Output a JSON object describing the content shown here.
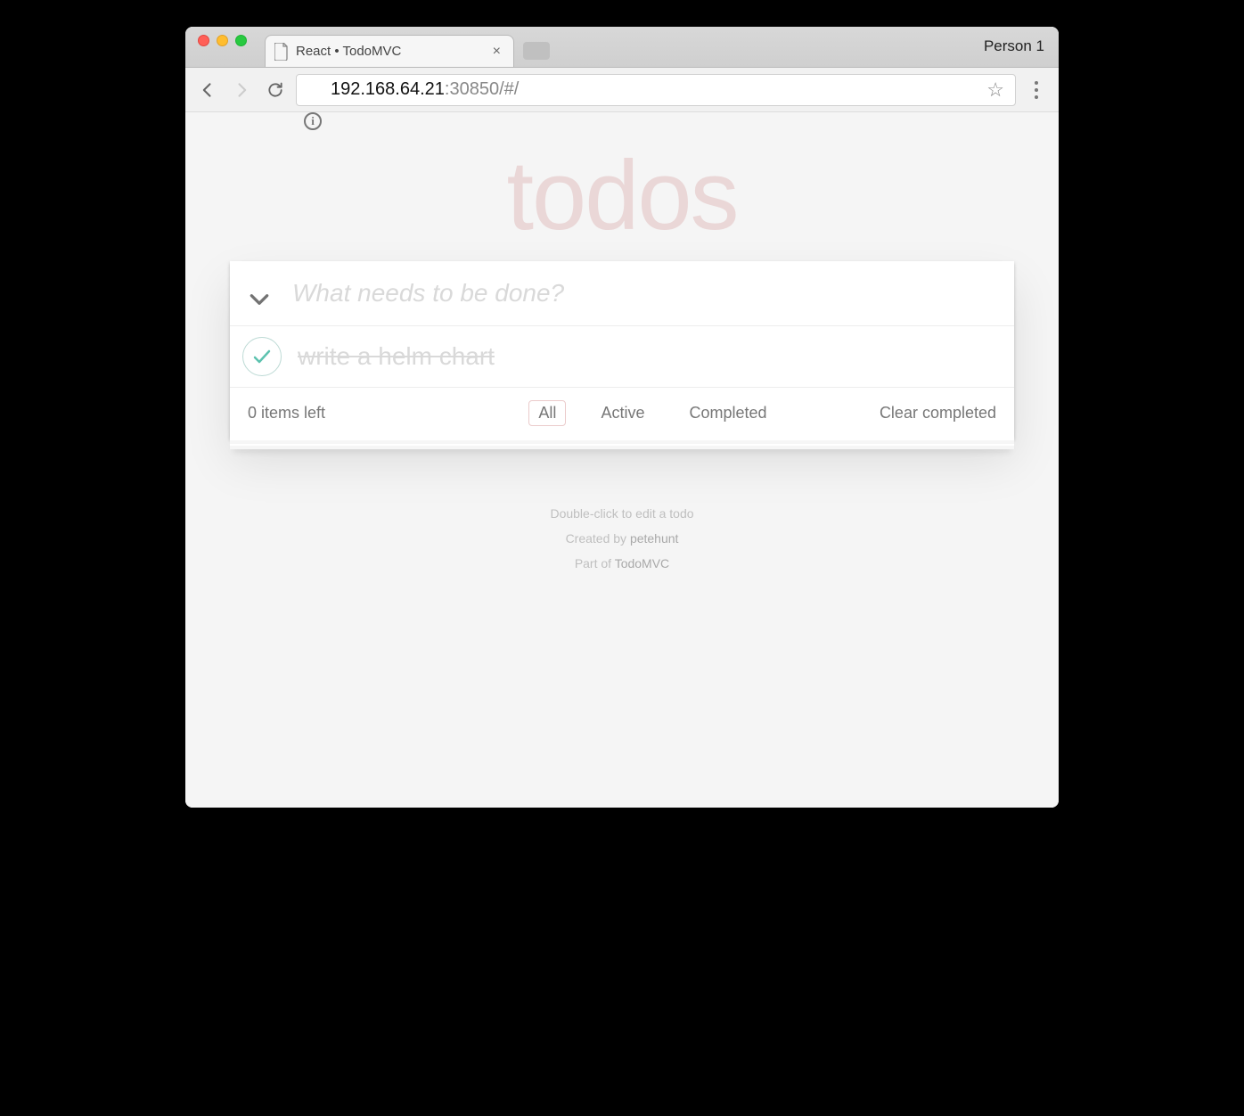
{
  "browser": {
    "tab_title": "React • TodoMVC",
    "profile_label": "Person 1",
    "url_host": "192.168.64.21",
    "url_rest": ":30850/#/"
  },
  "app": {
    "title": "todos",
    "input_placeholder": "What needs to be done?",
    "todos": [
      {
        "text": "write a helm chart",
        "completed": true
      }
    ],
    "items_left": "0 items left",
    "filters": {
      "all": "All",
      "active": "Active",
      "completed": "Completed",
      "selected": "all"
    },
    "clear_label": "Clear completed"
  },
  "footer_info": {
    "line1": "Double-click to edit a todo",
    "line2_prefix": "Created by ",
    "line2_link": "petehunt",
    "line3_prefix": "Part of ",
    "line3_link": "TodoMVC"
  }
}
